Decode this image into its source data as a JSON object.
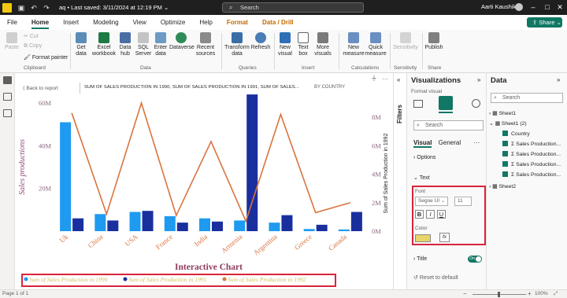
{
  "titlebar": {
    "doc_name": "aq",
    "saved": "Last saved: 3/11/2024 at 12:19 PM",
    "search_placeholder": "Search",
    "user_name": "Aarti Kaushik"
  },
  "menu": {
    "items": [
      "File",
      "Home",
      "Insert",
      "Modeling",
      "View",
      "Optimize",
      "Help"
    ],
    "context_items": [
      "Format",
      "Data / Drill"
    ],
    "share_label": "Share"
  },
  "ribbon": {
    "clipboard": {
      "paste": "Paste",
      "cut": "Cut",
      "copy": "Copy",
      "format_painter": "Format painter",
      "group": "Clipboard"
    },
    "data": {
      "get_data": "Get data",
      "excel": "Excel workbook",
      "data_hub": "Data hub",
      "sql": "SQL Server",
      "enter": "Enter data",
      "dataverse": "Dataverse",
      "recent": "Recent sources",
      "group": "Data"
    },
    "queries": {
      "transform": "Transform data",
      "refresh": "Refresh",
      "group": "Queries"
    },
    "insert": {
      "new_visual": "New visual",
      "text_box": "Text box",
      "more_visuals": "More visuals",
      "group": "Insert"
    },
    "calculations": {
      "new_measure": "New measure",
      "quick_measure": "Quick measure",
      "group": "Calculations"
    },
    "sensitivity": {
      "label": "Sensitivity",
      "group": "Sensitivity"
    },
    "share": {
      "publish": "Publish",
      "group": "Share"
    }
  },
  "canvas": {
    "back_label": "Back to report",
    "visual_header": "SUM OF SALES PRODUCTION IN 1990, SUM OF SALES PRODUCTION IN 1991, SUM OF SALES...",
    "by_label": "BY COUNTRY"
  },
  "chart_data": {
    "type": "bar",
    "title": "Interactive Chart",
    "ylabel": "Sales productions",
    "y2label": "Sum of Sales Production in 1992",
    "ylim": [
      0,
      60000000
    ],
    "y2lim": [
      0,
      9000000
    ],
    "y_ticks": [
      "20M",
      "40M",
      "60M"
    ],
    "y2_ticks": [
      "0M",
      "2M",
      "4M",
      "6M",
      "8M"
    ],
    "categories": [
      "Uk",
      "China",
      "USA",
      "France",
      "India",
      "Armenia",
      "Argentina",
      "Greece",
      "Canada"
    ],
    "series": [
      {
        "name": "Sum of Sales Production in 1990",
        "kind": "bar",
        "axis": "left",
        "color": "#1e9af0",
        "values": [
          51000000,
          8000000,
          9000000,
          7000000,
          6000000,
          5000000,
          4000000,
          1000000,
          800000
        ]
      },
      {
        "name": "Sum of Sales Production in 1991",
        "kind": "bar",
        "axis": "left",
        "color": "#1a2f9e",
        "values": [
          6000000,
          5000000,
          9500000,
          4000000,
          4500000,
          64000000,
          7500000,
          3000000,
          9000000
        ]
      },
      {
        "name": "Sum of Sales Production in 1992",
        "kind": "line",
        "axis": "right",
        "color": "#d9743f",
        "values": [
          8300000,
          1200000,
          9000000,
          1100000,
          6300000,
          700000,
          8200000,
          1300000,
          2000000
        ]
      }
    ],
    "legend_position": "bottom-left"
  },
  "filters_label": "Filters",
  "viz_pane": {
    "title": "Visualizations",
    "subtitle": "Format visual",
    "search": "Search",
    "tabs": [
      "Visual",
      "General"
    ],
    "options_label": "Options",
    "text_label": "Text",
    "font_label": "Font",
    "font_family": "Segoe UI",
    "font_size": "11",
    "bold": "B",
    "italic": "I",
    "underline": "U",
    "color_label": "Color",
    "color_value": "#e8d56a",
    "fx": "fx",
    "title_label": "Title",
    "title_toggle": "On",
    "reset": "Reset to default"
  },
  "data_pane": {
    "title": "Data",
    "search": "Search",
    "tree": [
      {
        "label": "Sheet1",
        "level": 0
      },
      {
        "label": "Sheet1 (2)",
        "level": 0
      },
      {
        "label": "Country",
        "level": 1
      },
      {
        "label": "Sales Production...",
        "level": 1,
        "sigma": true
      },
      {
        "label": "Sales Production...",
        "level": 1,
        "sigma": true
      },
      {
        "label": "Sales Production...",
        "level": 1,
        "sigma": true
      },
      {
        "label": "Sales Production...",
        "level": 1,
        "sigma": true
      },
      {
        "label": "Sheet2",
        "level": 0
      }
    ]
  },
  "status": {
    "page": "Page 1 of 1",
    "zoom": "100%"
  }
}
